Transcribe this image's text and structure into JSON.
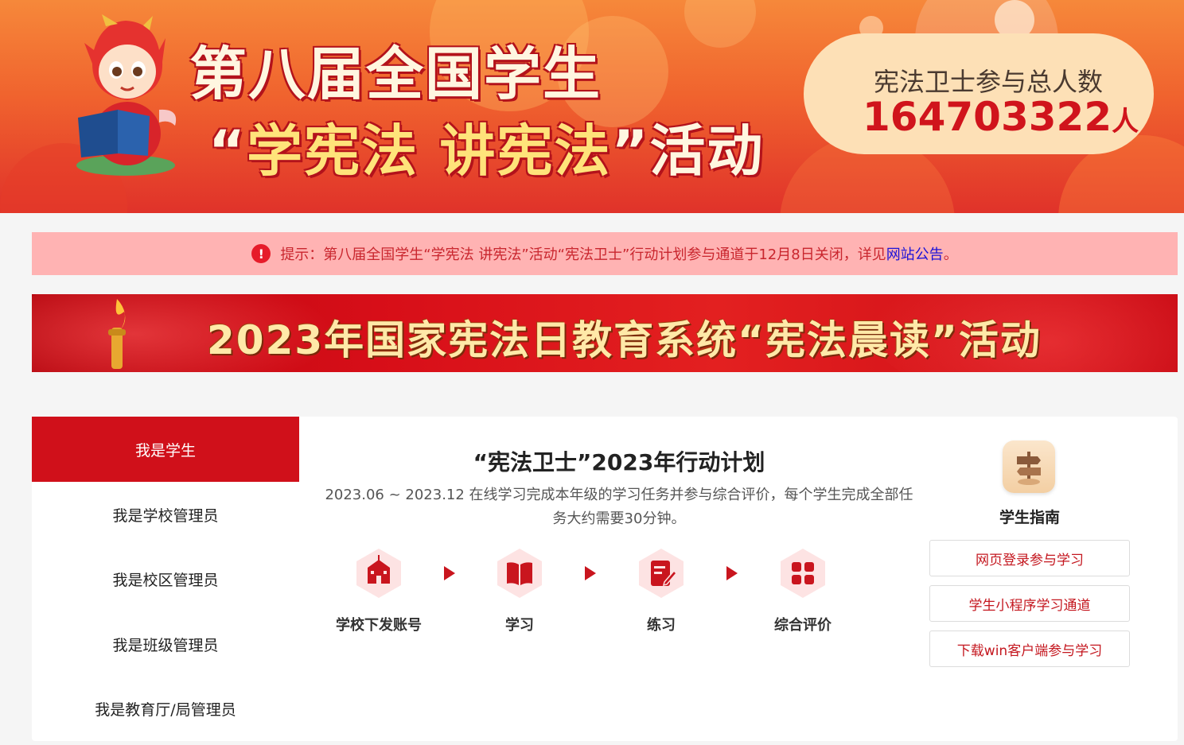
{
  "hero": {
    "title_line1": "第八届全国学生",
    "title_line2_open": "“",
    "title_line2_highlight": "学宪法  讲宪法",
    "title_line2_close": "”",
    "title_line2_tail": "活动",
    "counter_label": "宪法卫士参与总人数",
    "counter_value": "164703322",
    "counter_unit": "人",
    "colors": {
      "accent": "#d0141c",
      "banner_top": "#f6883a",
      "banner_bottom": "#e0322a"
    }
  },
  "notice": {
    "icon": "exclamation-circle-icon",
    "text": "提示：第八届全国学生“学宪法 讲宪法”活动“宪法卫士”行动计划参与通道于12月8日关闭，详见",
    "link_text": "网站公告",
    "suffix": "。"
  },
  "promo": {
    "text": "2023年国家宪法日教育系统“宪法晨读”活动"
  },
  "sidebar": {
    "items": [
      {
        "label": "我是学生",
        "active": true
      },
      {
        "label": "我是学校管理员",
        "active": false
      },
      {
        "label": "我是校区管理员",
        "active": false
      },
      {
        "label": "我是班级管理员",
        "active": false
      },
      {
        "label": "我是教育厅/局管理员",
        "active": false
      }
    ]
  },
  "plan": {
    "title": "“宪法卫士”2023年行动计划",
    "description": "2023.06 ~ 2023.12 在线学习完成本年级的学习任务并参与综合评价，每个学生完成全部任务大约需要30分钟。",
    "steps": [
      {
        "label": "学校下发账号",
        "icon": "school-icon"
      },
      {
        "label": "学习",
        "icon": "book-icon"
      },
      {
        "label": "练习",
        "icon": "edit-document-icon"
      },
      {
        "label": "综合评价",
        "icon": "grid-icon"
      }
    ]
  },
  "guide": {
    "icon": "signpost-icon",
    "title": "学生指南",
    "buttons": [
      "网页登录参与学习",
      "学生小程序学习通道",
      "下载win客户端参与学习"
    ]
  }
}
